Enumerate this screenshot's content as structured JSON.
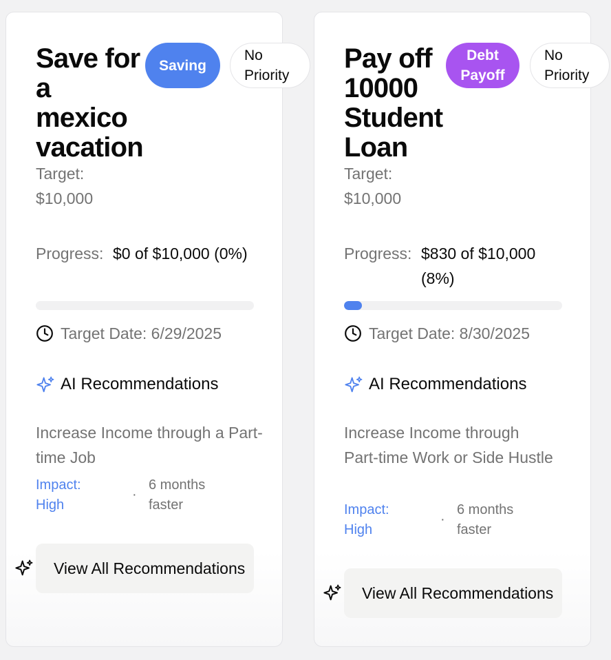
{
  "colors": {
    "accent_blue": "#4f82ee",
    "saving_badge": "#4f82ee",
    "debt_badge": "#a854f0"
  },
  "goals": [
    {
      "title": "Save for a mexico vacation",
      "type_badge": "Saving",
      "priority_badge": "No Priority",
      "target_label": "Target:",
      "target_value": "$10,000",
      "progress_label": "Progress:",
      "progress_value": "$0 of $10,000 (0%)",
      "progress_fraction": 0.0,
      "target_date": "Target Date: 6/29/2025",
      "ai_title": "AI Recommendations",
      "recommendation": "Increase Income through a Part-time Job",
      "impact": "Impact: High",
      "separator": "·",
      "time_saved": "6 months faster",
      "view_all": "View All Recommendations"
    },
    {
      "title": "Pay off 10000 Student Loan",
      "type_badge": "Debt Payoff",
      "priority_badge": "No Priority",
      "target_label": "Target:",
      "target_value": "$10,000",
      "progress_label": "Progress:",
      "progress_value": "$830 of $10,000 (8%)",
      "progress_fraction": 0.083,
      "target_date": "Target Date: 8/30/2025",
      "ai_title": "AI Recommendations",
      "recommendation": "Increase Income through Part-time Work or Side Hustle",
      "impact": "Impact: High",
      "separator": "·",
      "time_saved": "6 months faster",
      "view_all": "View All Recommendations"
    }
  ]
}
